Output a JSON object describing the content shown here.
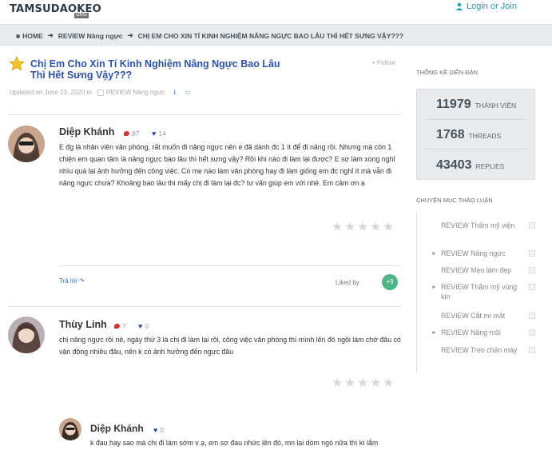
{
  "header": {
    "logo": "TAMSUDAOKEO",
    "logo_sub": "ORG",
    "login": "Login or Join"
  },
  "breadcrumb": {
    "home": "HOME",
    "section": "REVIEW Nâng ngực",
    "current": "CHỊ EM CHO XIN TÍ KINH NGHIỆM NÂNG NGỰC BAO LÂU THÌ HẾT SƯNG VẬY???"
  },
  "thread": {
    "title": "Chị Em Cho Xin Tí Kinh Nghiệm Nâng Ngực Bao Lâu Thì Hết Sưng Vậy???",
    "follow": "Follow",
    "meta_updated": "Updated on June 23, 2020 in",
    "meta_category": "REVIEW Nâng ngực"
  },
  "posts": [
    {
      "author": "Diệp Khánh",
      "comments": "87",
      "likes": "14",
      "body": "E đg là nhân viên văn phòng, rất muốn đi nâng ngực nên e đã dành đc 1 ít để đi nâng rồi. Nhưng mà còn 1 chiện em quan tâm là nâng ngực bao lâu thì hết sưng vậy? Rồi khi nào đi làm lại được? E sợ làm xong nghỉ nhìu quá lại ảnh hưởng đến công việc. Có mẹ nào làm văn phòng hay đi làm giống em đc nghỉ ít mà vẫn đi nâng ngực chưa? Khoảng bao lâu thì mấy chị đi làm lại đc? tư vấn giúp em với nhé. Em cảm ơn ạ",
      "reply": "Trả lời",
      "liked_by": "Liked by",
      "like_badge": "+9"
    },
    {
      "author": "Thùy Linh",
      "comments": "7",
      "likes": "0",
      "body": "chị nâng ngực rồi nè, ngày thứ 3 là chị đi làm lại rồi, công việc văn phòng thì mình lên đó ngồi làm chớ đâu có vận động nhiều đâu, nên k có ảnh hưởng đến ngực đâu"
    },
    {
      "author": "Diệp Khánh",
      "likes": "0",
      "body": "k đau hay sao mà chị đi làm sớm v ạ, em sợ đau nhức lên đó, mn lại dòm ngó nữa thì kì lắm"
    }
  ],
  "sidebar": {
    "stats_title": "THỐNG KÊ DIỄN ĐÀN",
    "stats": [
      {
        "num": "11979",
        "label": "THÀNH VIÊN"
      },
      {
        "num": "1768",
        "label": "THREADS"
      },
      {
        "num": "43403",
        "label": "REPLIES"
      }
    ],
    "cats_title": "CHUYÊN MỤC THẢO LUẬN",
    "categories": [
      {
        "label": "REVIEW Thẩm mỹ viện",
        "expandable": false
      },
      {
        "label": "REVIEW Nâng ngực",
        "expandable": true
      },
      {
        "label": "REVIEW Mẹo làm đẹp",
        "expandable": false
      },
      {
        "label": "REVIEW Thẩm mỹ vùng kín",
        "expandable": true
      },
      {
        "label": "REVIEW Cắt mí mắt",
        "expandable": false
      },
      {
        "label": "REVIEW Nâng mũi",
        "expandable": true
      },
      {
        "label": "REVIEW Treo chân mày",
        "expandable": false
      }
    ]
  },
  "colors": {
    "accent": "#2c53a7",
    "login": "#1aa3b8",
    "like_badge": "#4fb487",
    "heart": "#2a3fa8",
    "comment": "#d8322c"
  }
}
